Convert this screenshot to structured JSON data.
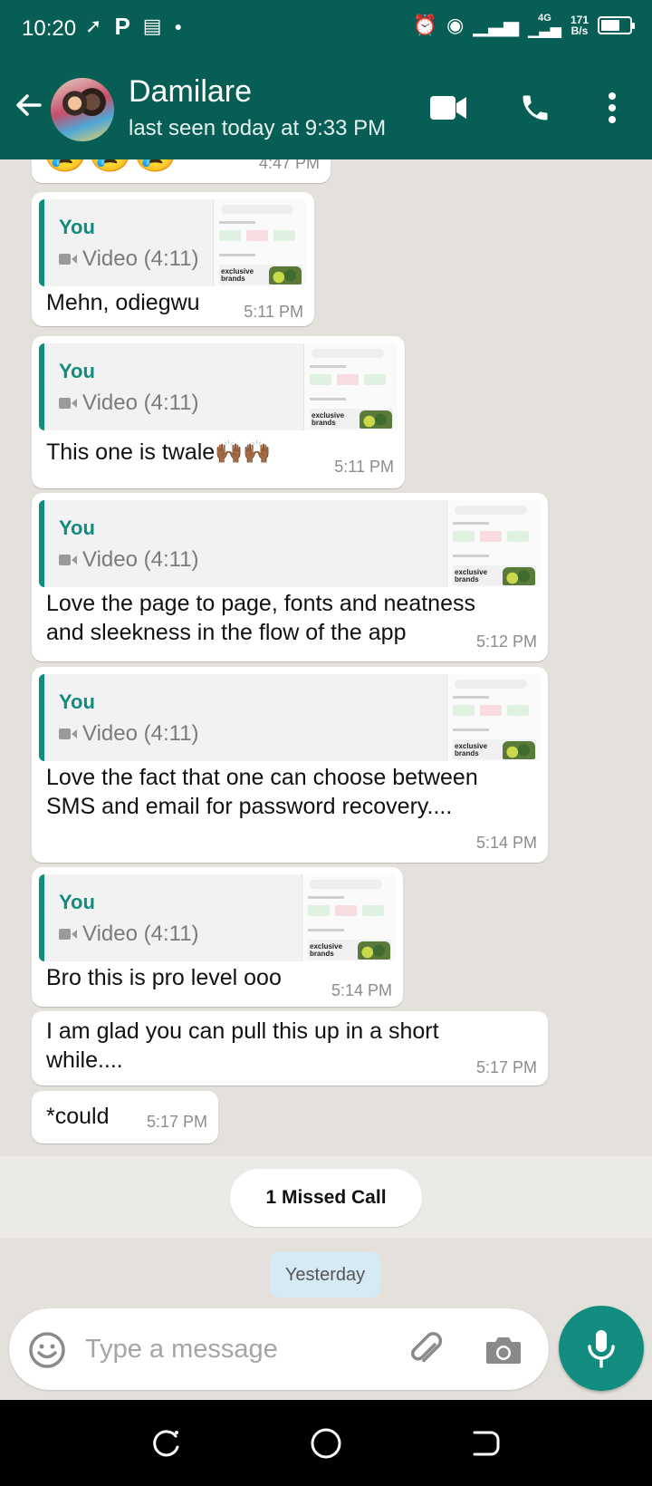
{
  "status_bar": {
    "time": "10:20",
    "left_icons": [
      "signal-boost-icon",
      "p-app-icon",
      "news-icon",
      "dot-icon"
    ],
    "net_label": "4G",
    "net_speed_value": "171",
    "net_speed_unit": "B/s",
    "right_icons": [
      "alarm-icon",
      "hotspot-icon",
      "signal-icon",
      "signal-icon-2",
      "battery-icon"
    ]
  },
  "header": {
    "contact_name": "Damilare",
    "last_seen": "last seen today at 9:33 PM",
    "accent": "#075e54"
  },
  "messages": [
    {
      "type": "partial",
      "emoji": "😢😢😢",
      "time": "4:47 PM"
    },
    {
      "reply_author": "You",
      "reply_media": "Video (4:11)",
      "text": "Mehn, odiegwu",
      "time": "5:11 PM"
    },
    {
      "reply_author": "You",
      "reply_media": "Video (4:11)",
      "text": "This one is twale🙌🏾🙌🏾",
      "time": "5:11 PM"
    },
    {
      "reply_author": "You",
      "reply_media": "Video (4:11)",
      "text_line1": "Love the page to page, fonts and neatness",
      "text_line2": "and sleekness in the flow of the app",
      "time": "5:12 PM"
    },
    {
      "reply_author": "You",
      "reply_media": "Video (4:11)",
      "text_line1": "Love the fact that one can choose between",
      "text_line2": "SMS and email for password recovery....",
      "time": "5:14 PM"
    },
    {
      "reply_author": "You",
      "reply_media": "Video (4:11)",
      "text": "Bro this is pro level ooo",
      "time": "5:14 PM"
    },
    {
      "text_line1": "I am glad you can pull this up in a short",
      "text_line2": "while....",
      "time": "5:17 PM"
    },
    {
      "text": "*could",
      "time": "5:17 PM"
    }
  ],
  "thumbnail": {
    "banner_line1": "exclusive",
    "banner_line2": "brands"
  },
  "missed_call": "1 Missed Call",
  "date_divider": "Yesterday",
  "composer": {
    "placeholder": "Type a message"
  },
  "colors": {
    "brand": "#075e54",
    "accent": "#128c7e",
    "chat_bg": "#e4e1dc"
  }
}
